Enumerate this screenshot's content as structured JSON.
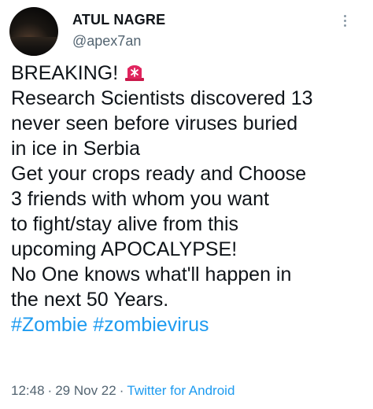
{
  "author": {
    "display_name": "ATUL NAGRE",
    "handle": "@apex7an"
  },
  "tweet": {
    "lines": [
      "BREAKING!",
      "Research Scientists discovered 13",
      "never seen before viruses buried",
      "in ice in Serbia",
      "Get your crops ready and Choose",
      "3 friends with whom you want",
      "to fight/stay alive from this",
      "upcoming APOCALYPSE!",
      "No One knows what'll happen in",
      "the next 50 Years."
    ],
    "emoji_icon": "police-car-light-icon",
    "hashtags": [
      "#Zombie",
      "#zombievirus"
    ]
  },
  "meta": {
    "time": "12:48",
    "date": "29 Nov 22",
    "separator": "·",
    "source": "Twitter for Android"
  },
  "colors": {
    "text": "#0f1419",
    "secondary": "#536471",
    "link": "#1d9bf0",
    "siren": "#e0245e"
  }
}
